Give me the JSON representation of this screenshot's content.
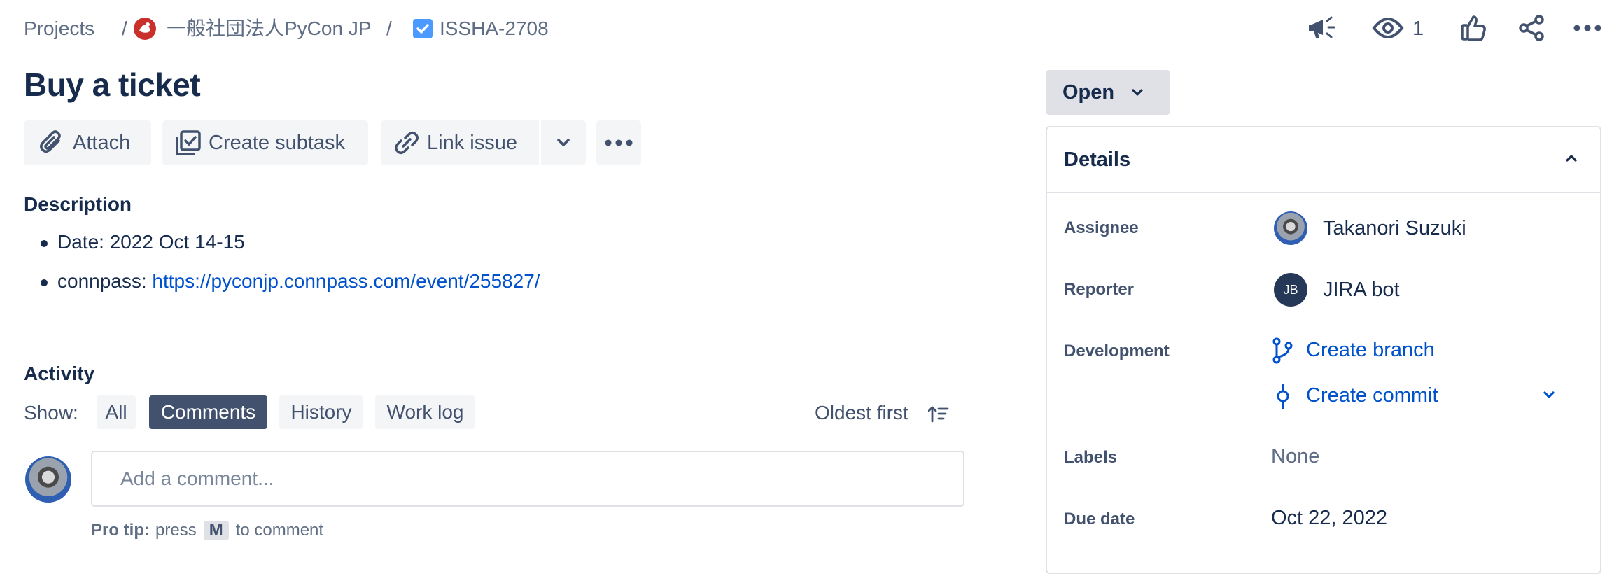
{
  "breadcrumb": {
    "projects": "Projects",
    "separator": "/",
    "org_name": "一般社団法人PyCon JP",
    "issue_key": "ISSHA-2708"
  },
  "top_actions": {
    "watch_count": "1"
  },
  "issue": {
    "title": "Buy a ticket"
  },
  "toolbar": {
    "attach_label": "Attach",
    "create_subtask_label": "Create subtask",
    "link_issue_label": "Link issue"
  },
  "description": {
    "heading": "Description",
    "items": [
      {
        "label": "Date: 2022 Oct 14-15"
      },
      {
        "label": "connpass: ",
        "link": "https://pyconjp.connpass.com/event/255827/"
      }
    ]
  },
  "activity": {
    "heading": "Activity",
    "show_label": "Show:",
    "filters": [
      "All",
      "Comments",
      "History",
      "Work log"
    ],
    "active_filter": "Comments",
    "sort_label": "Oldest first",
    "comment_placeholder": "Add a comment...",
    "pro_tip_bold": "Pro tip:",
    "pro_tip_press": "press",
    "pro_tip_key": "M",
    "pro_tip_rest": "to comment"
  },
  "status": {
    "label": "Open"
  },
  "details": {
    "heading": "Details",
    "assignee_label": "Assignee",
    "assignee_name": "Takanori Suzuki",
    "reporter_label": "Reporter",
    "reporter_initials": "JB",
    "reporter_name": "JIRA bot",
    "development_label": "Development",
    "create_branch": "Create branch",
    "create_commit": "Create commit",
    "labels_label": "Labels",
    "labels_value": "None",
    "due_date_label": "Due date",
    "due_date_value": "Oct 22, 2022"
  },
  "colors": {
    "link": "#0052cc",
    "text": "#172b4d",
    "subtle": "#42526e",
    "button_bg": "#f4f5f7",
    "active_filter_bg": "#42526e",
    "checkbox_blue": "#4c9aff",
    "avatar_navy": "#253858"
  },
  "icons": [
    "pycon-logo-icon",
    "task-checkbox-icon",
    "megaphone-icon",
    "eye-icon",
    "thumbs-up-icon",
    "share-icon",
    "more-icon",
    "paperclip-icon",
    "subtask-icon",
    "link-icon",
    "chevron-down-icon",
    "sort-icon",
    "chevron-up-icon",
    "branch-icon",
    "commit-icon"
  ]
}
